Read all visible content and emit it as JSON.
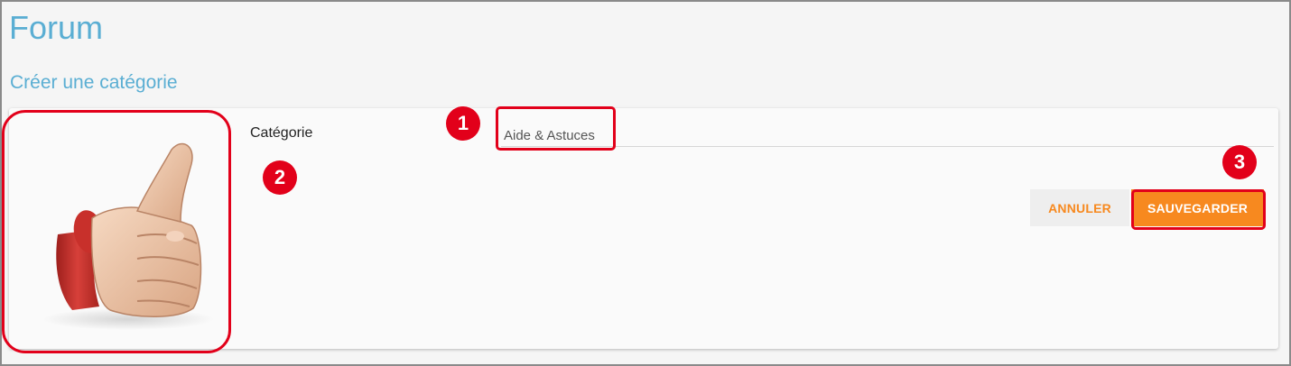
{
  "page": {
    "title": "Forum",
    "section_title": "Créer une catégorie"
  },
  "form": {
    "category_label": "Catégorie",
    "category_value": "Aide & Astuces"
  },
  "actions": {
    "cancel_label": "ANNULER",
    "save_label": "SAUVEGARDER"
  },
  "annotations": {
    "badge_1": "1",
    "badge_2": "2",
    "badge_3": "3"
  },
  "image": {
    "icon": "thumbs-up-icon"
  },
  "colors": {
    "title": "#5aaed3",
    "accent_orange": "#f7891f",
    "highlight_red": "#e2001a"
  }
}
